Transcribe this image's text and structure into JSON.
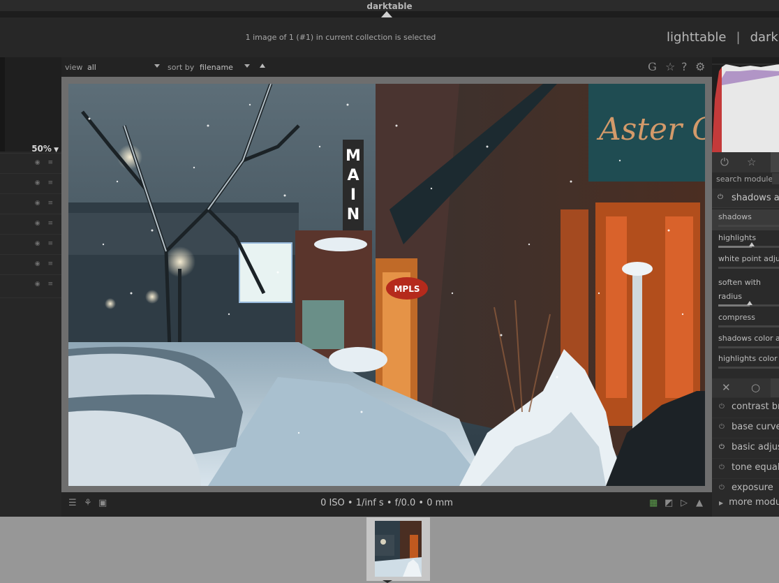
{
  "app": {
    "title": "darktable"
  },
  "header": {
    "status": "1 image of 1 (#1) in current collection is selected",
    "views": [
      "lighttable",
      "darkroom"
    ],
    "views_separator": "|"
  },
  "left_panel": {
    "zoom": "50%"
  },
  "toolbar": {
    "view_label": "view",
    "view_value": "all",
    "sort_label": "sort by",
    "sort_value": "filename",
    "icons": [
      "grouping-icon",
      "star-icon",
      "help-icon",
      "gear-icon"
    ]
  },
  "image": {
    "description_text": {
      "sign_vertical": "MAIN",
      "sign_oval": "MPLS",
      "sign_top_right": "Aster Cafe"
    }
  },
  "info_bar": {
    "exif": "0 ISO • 1/inf s • f/0.0 • 0 mm",
    "icons_left": [
      "list-icon",
      "overlay-icon",
      "display-icon"
    ],
    "icons_right": [
      "color-icon",
      "softproof-icon",
      "gamut-icon",
      "warning-icon"
    ]
  },
  "right_panel": {
    "search_label": "search module",
    "active_module": "shadows and highlights",
    "params": [
      {
        "label": "shadows",
        "value": 1.0
      },
      {
        "label": "highlights",
        "value": 0.5
      },
      {
        "label": "white point adjustment",
        "value": 0.0
      },
      {
        "label": "radius",
        "value": 0.5
      },
      {
        "label": "compress",
        "value": 0.0
      },
      {
        "label": "shadows color adjustment",
        "value": 0.0
      },
      {
        "label": "highlights color adjustment",
        "value": 0.0
      }
    ],
    "soften_label": "soften with",
    "modules": [
      "contrast brightness saturation",
      "base curve",
      "basic adjustments",
      "tone equalizer",
      "exposure"
    ],
    "more_modules": "more modules"
  },
  "colors": {
    "background": "#232323",
    "panel": "#272727",
    "filmstrip": "#979797",
    "image_frame": "#6e6e6e"
  }
}
